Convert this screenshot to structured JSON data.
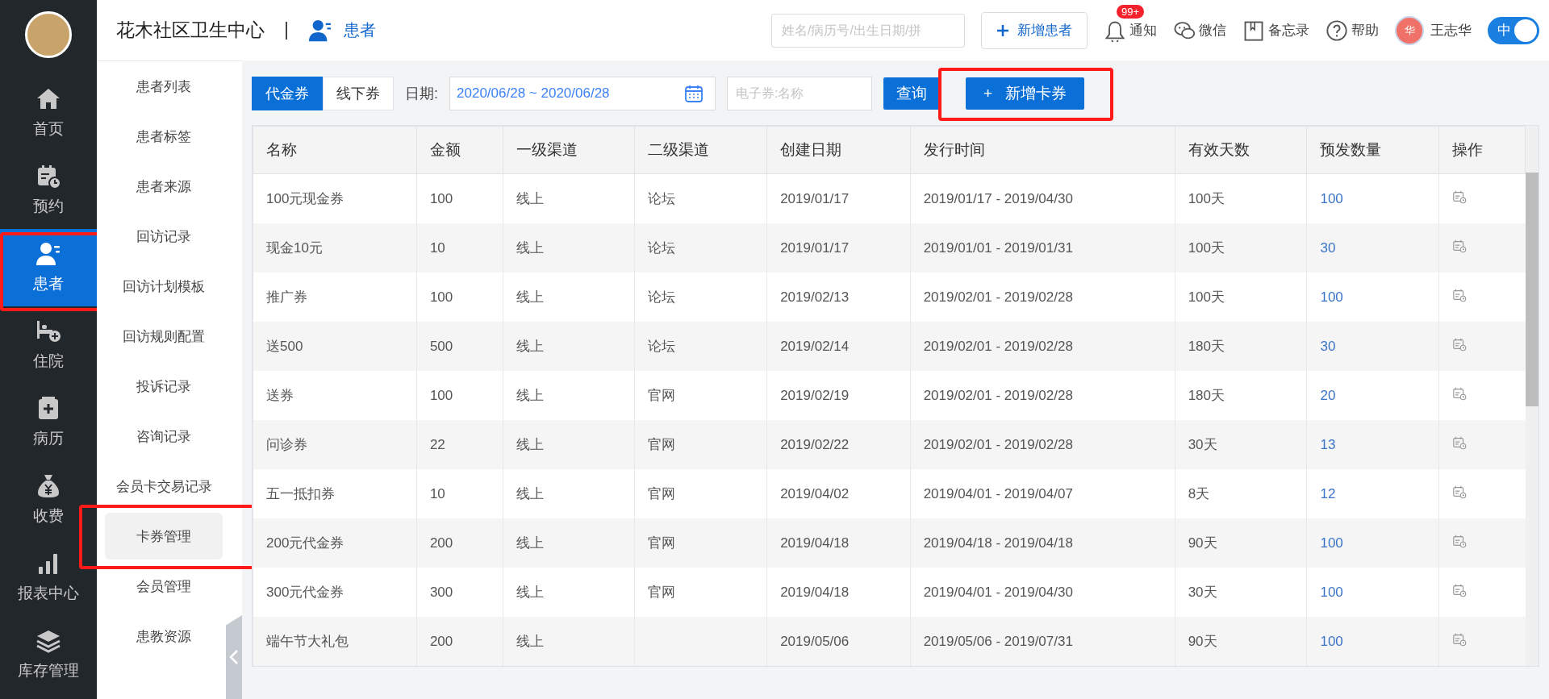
{
  "sidebar": {
    "items": [
      {
        "kind": "home",
        "label": "首页",
        "selected": false,
        "highlighted": false
      },
      {
        "kind": "appointment",
        "label": "预约",
        "selected": false,
        "highlighted": false
      },
      {
        "kind": "patient",
        "label": "患者",
        "selected": true,
        "highlighted": true
      },
      {
        "kind": "bed",
        "label": "住院",
        "selected": false,
        "highlighted": false
      },
      {
        "kind": "record",
        "label": "病历",
        "selected": false,
        "highlighted": false
      },
      {
        "kind": "money",
        "label": "收费",
        "selected": false,
        "highlighted": false
      },
      {
        "kind": "chart",
        "label": "报表中心",
        "selected": false,
        "highlighted": false
      },
      {
        "kind": "stock",
        "label": "库存管理",
        "selected": false,
        "highlighted": false
      }
    ]
  },
  "header": {
    "title": "花木社区卫生中心",
    "module": "患者",
    "search": {
      "placeholder": "姓名/病历号/出生日期/拼"
    },
    "add_button": "新增患者",
    "tools": [
      {
        "kind": "bell",
        "label": "通知",
        "badge": "99+"
      },
      {
        "kind": "chat",
        "label": "微信"
      },
      {
        "kind": "book",
        "label": "备忘录"
      },
      {
        "kind": "help",
        "label": "帮助"
      }
    ],
    "user": {
      "avatar_text": "华",
      "name": "王志华"
    },
    "toggle": {
      "label": "中",
      "on": true
    }
  },
  "submenu": {
    "items": [
      {
        "label": "患者列表",
        "selected": false,
        "highlighted": false
      },
      {
        "label": "患者标签",
        "selected": false,
        "highlighted": false
      },
      {
        "label": "患者来源",
        "selected": false,
        "highlighted": false
      },
      {
        "label": "回访记录",
        "selected": false,
        "highlighted": false
      },
      {
        "label": "回访计划模板",
        "selected": false,
        "highlighted": false
      },
      {
        "label": "回访规则配置",
        "selected": false,
        "highlighted": false
      },
      {
        "label": "投诉记录",
        "selected": false,
        "highlighted": false
      },
      {
        "label": "咨询记录",
        "selected": false,
        "highlighted": false
      },
      {
        "label": "会员卡交易记录",
        "selected": false,
        "highlighted": false
      },
      {
        "label": "卡券管理",
        "selected": true,
        "highlighted": true
      },
      {
        "label": "会员管理",
        "selected": false,
        "highlighted": false
      },
      {
        "label": "患教资源",
        "selected": false,
        "highlighted": false
      }
    ]
  },
  "toolbar": {
    "tabs": [
      {
        "label": "代金券",
        "selected": true
      },
      {
        "label": "线下券",
        "selected": false
      }
    ],
    "date_label": "日期:",
    "date_range": "2020/06/28 ~ 2020/06/28",
    "name_field": {
      "placeholder": "电子券:名称"
    },
    "query_button": "查询",
    "add_button": {
      "plus": "+",
      "label": "新增卡券",
      "highlighted": true
    }
  },
  "table": {
    "columns": [
      "名称",
      "金额",
      "一级渠道",
      "二级渠道",
      "创建日期",
      "发行时间",
      "有效天数",
      "预发数量",
      "操作"
    ],
    "rows": [
      [
        "100元现金券",
        "100",
        "线上",
        "论坛",
        "2019/01/17",
        "2019/01/17 - 2019/04/30",
        "100天",
        "100"
      ],
      [
        "现金10元",
        "10",
        "线上",
        "论坛",
        "2019/01/17",
        "2019/01/01 - 2019/01/31",
        "100天",
        "30"
      ],
      [
        "推广券",
        "100",
        "线上",
        "论坛",
        "2019/02/13",
        "2019/02/01 - 2019/02/28",
        "100天",
        "100"
      ],
      [
        "送500",
        "500",
        "线上",
        "论坛",
        "2019/02/14",
        "2019/02/01 - 2019/02/28",
        "180天",
        "30"
      ],
      [
        "送券",
        "100",
        "线上",
        "官网",
        "2019/02/19",
        "2019/02/01 - 2019/02/28",
        "180天",
        "20"
      ],
      [
        "问诊券",
        "22",
        "线上",
        "官网",
        "2019/02/22",
        "2019/02/01 - 2019/02/28",
        "30天",
        "13"
      ],
      [
        "五一抵扣券",
        "10",
        "线上",
        "官网",
        "2019/04/02",
        "2019/04/01 - 2019/04/07",
        "8天",
        "12"
      ],
      [
        "200元代金券",
        "200",
        "线上",
        "官网",
        "2019/04/18",
        "2019/04/18 - 2019/04/18",
        "90天",
        "100"
      ],
      [
        "300元代金券",
        "300",
        "线上",
        "官网",
        "2019/04/18",
        "2019/04/01 - 2019/04/30",
        "30天",
        "100"
      ],
      [
        "端午节大礼包",
        "200",
        "线上",
        "",
        "2019/05/06",
        "2019/05/06 - 2019/07/31",
        "90天",
        "100"
      ]
    ]
  }
}
